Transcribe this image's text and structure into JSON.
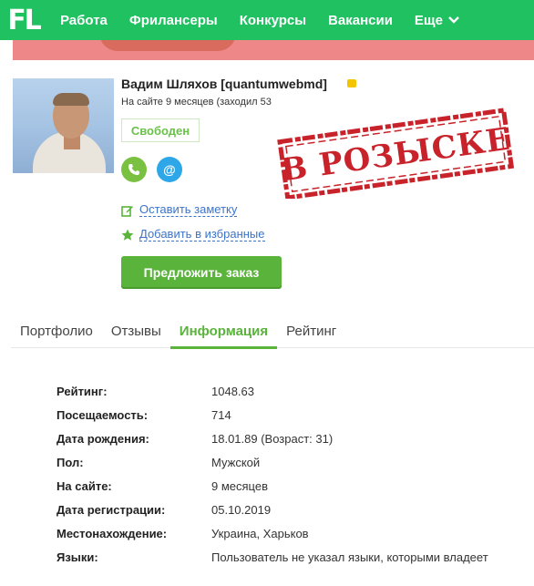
{
  "nav": {
    "logo": "FL",
    "items": [
      {
        "label": "Работа"
      },
      {
        "label": "Фрилансеры"
      },
      {
        "label": "Конкурсы"
      },
      {
        "label": "Вакансии"
      },
      {
        "label": "Еще"
      }
    ]
  },
  "profile": {
    "name": "Вадим Шляхов [quantumwebmd]",
    "on_site": "На сайте 9 месяцев (заходил 53",
    "status": "Свободен",
    "leave_note": "Оставить заметку",
    "add_favorite": "Добавить в избранные",
    "offer_button": "Предложить заказ"
  },
  "stamp": {
    "text": "В РОЗЫСКЕ",
    "color": "#c8222a"
  },
  "tabs": [
    {
      "label": "Портфолио"
    },
    {
      "label": "Отзывы"
    },
    {
      "label": "Информация"
    },
    {
      "label": "Рейтинг"
    }
  ],
  "info": [
    {
      "key": "Рейтинг:",
      "value": "1048.63"
    },
    {
      "key": "Посещаемость:",
      "value": "714"
    },
    {
      "key": "Дата рождения:",
      "value": "18.01.89 (Возраст: 31)"
    },
    {
      "key": "Пол:",
      "value": "Мужской"
    },
    {
      "key": "На сайте:",
      "value": "9 месяцев"
    },
    {
      "key": "Дата регистрации:",
      "value": "05.10.2019"
    },
    {
      "key": "Местонахождение:",
      "value": "Украина, Харьков"
    },
    {
      "key": "Языки:",
      "value": "Пользователь не указал языки, которыми владеет"
    }
  ],
  "colors": {
    "brand_green": "#1fc160",
    "button_green": "#5ab33b",
    "link_blue": "#3d74c7"
  }
}
